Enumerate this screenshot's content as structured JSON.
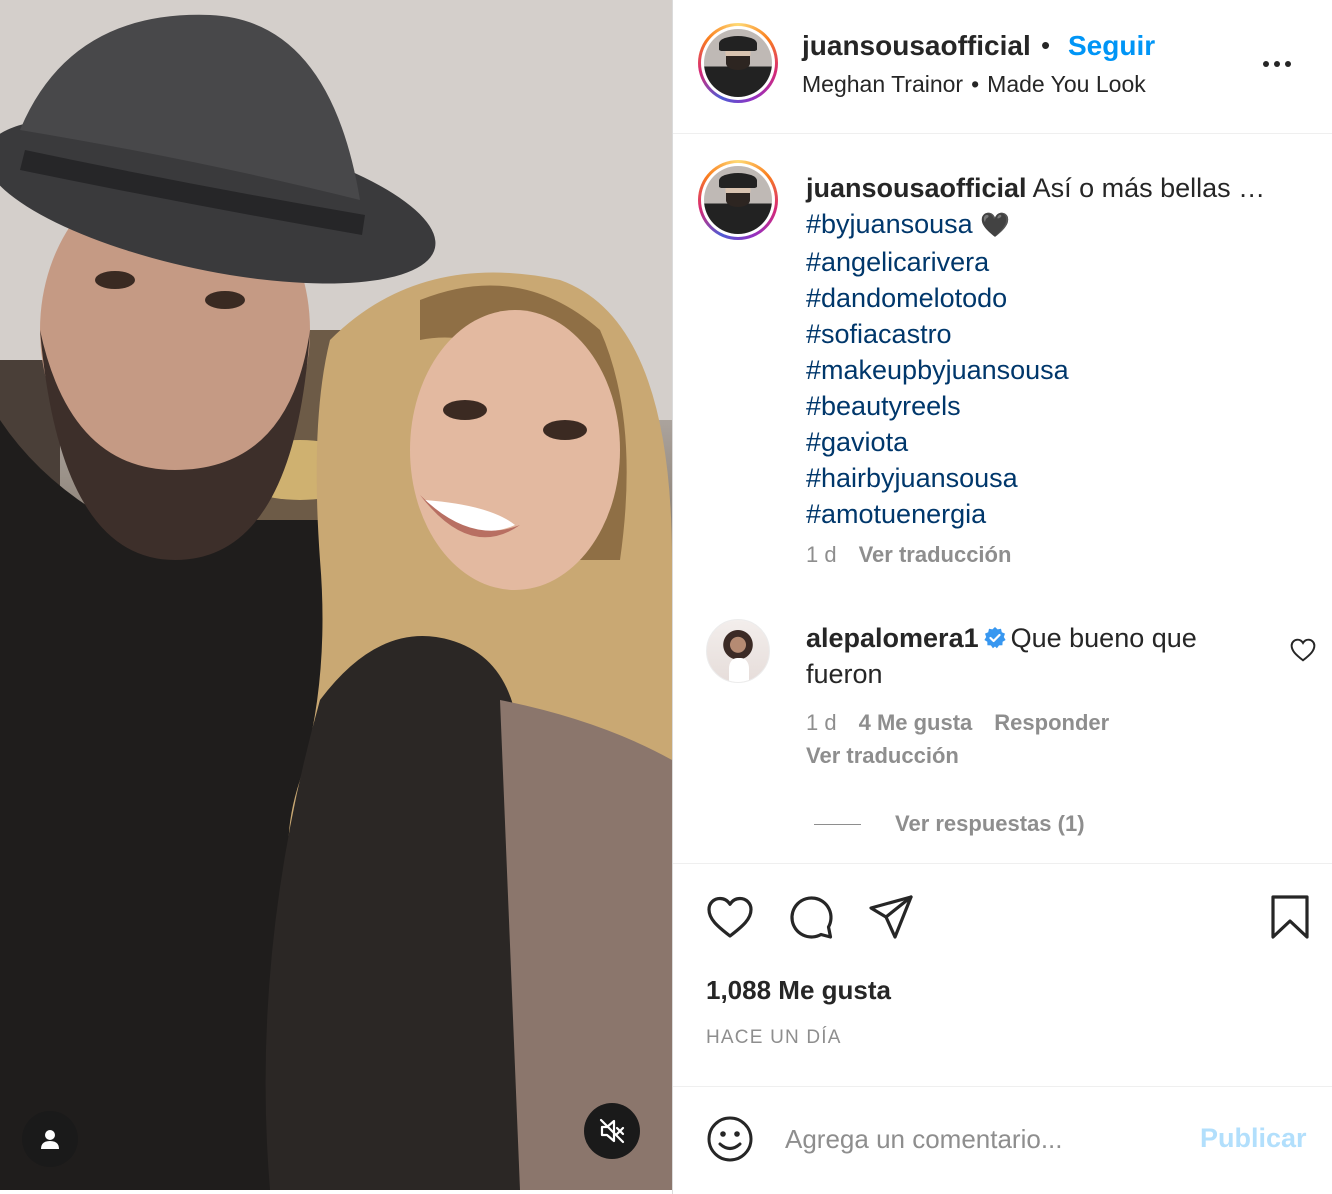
{
  "post": {
    "username": "juansousaofficial",
    "follow_label": "Seguir",
    "header_dot": "•",
    "audio": {
      "artist": "Meghan Trainor",
      "separator": "•",
      "song": "Made You Look"
    },
    "caption": {
      "username": "juansousaofficial",
      "text": "Así o más bellas …",
      "hashtags": [
        "#byjuansousa",
        "#angelicarivera",
        "#dandomelotodo",
        "#sofiacastro",
        "#makeupbyjuansousa",
        "#beautyreels",
        "#gaviota",
        "#hairbyjuansousa",
        "#amotuenergia"
      ],
      "emoji": "🖤",
      "age": "1 d",
      "translate_label": "Ver traducción"
    },
    "comment": {
      "username": "alepalomera1",
      "text": "Que bueno que fueron",
      "age": "1 d",
      "likes": "4 Me gusta",
      "reply_label": "Responder",
      "translate_label": "Ver traducción",
      "view_replies": "Ver respuestas (1)"
    },
    "likes": "1,088 Me gusta",
    "posted": "HACE UN DÍA",
    "comment_placeholder": "Agrega un comentario...",
    "publish_label": "Publicar"
  },
  "icons": {
    "header": [
      "avatar",
      "more-icon"
    ],
    "actions": [
      "heart-icon",
      "comment-icon",
      "share-icon",
      "bookmark-icon"
    ],
    "media": [
      "user-tag-icon",
      "muted-speaker-icon"
    ],
    "comment_box": [
      "emoji-icon"
    ],
    "comment": [
      "verified-badge-icon",
      "heart-outline-icon"
    ]
  },
  "colors": {
    "link_blue": "#0095f6",
    "hashtag_blue": "#00376b",
    "muted_gray": "#8e8e8e",
    "publish_disabled": "#b2dffc",
    "verified_blue": "#3897f0"
  }
}
